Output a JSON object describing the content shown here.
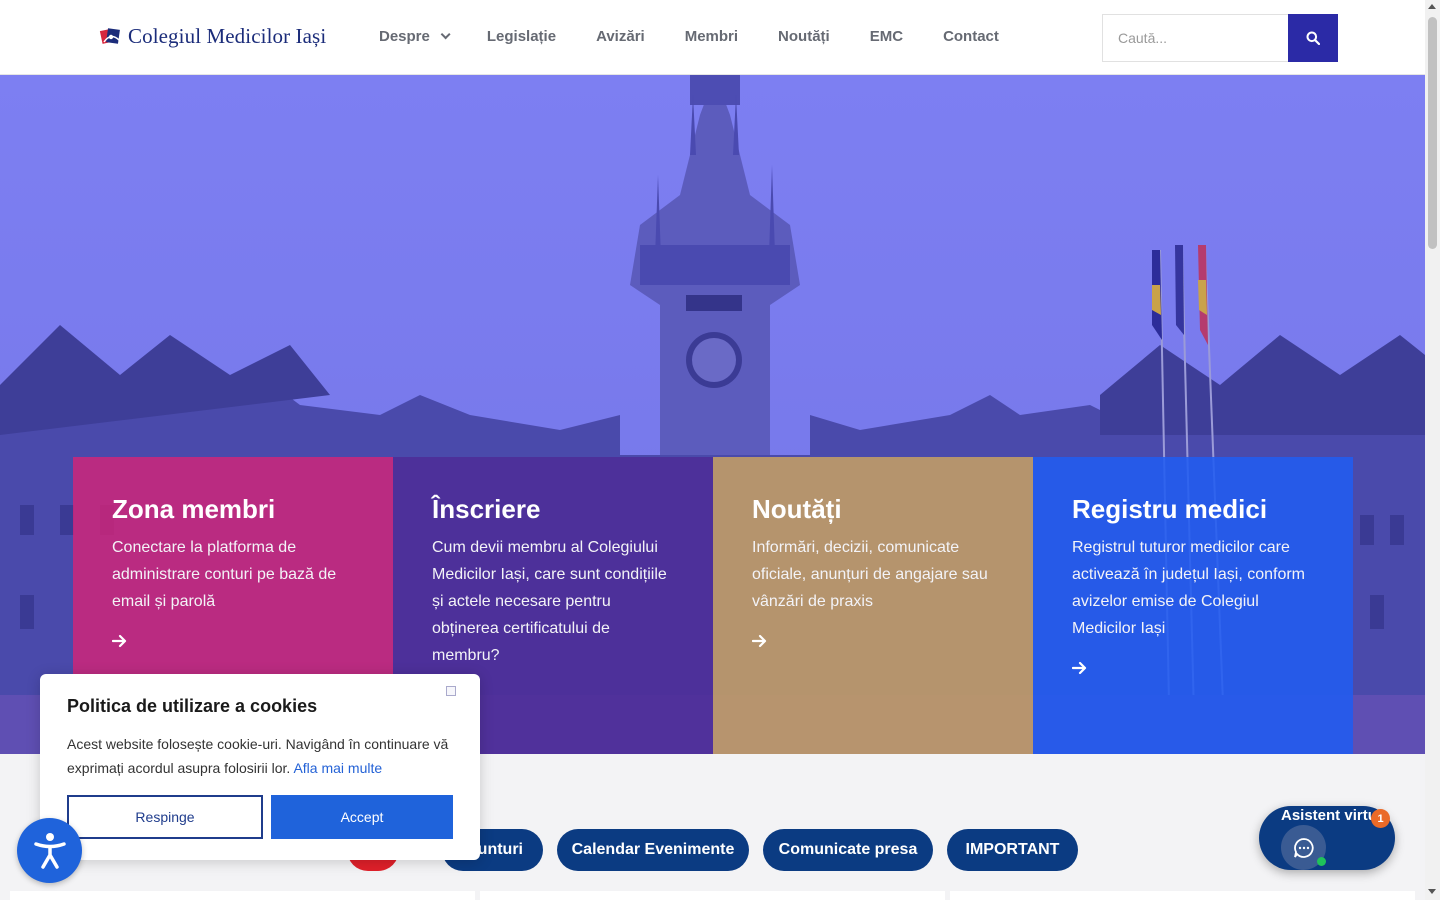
{
  "header": {
    "logo_text": "Colegiul Medicilor Iași",
    "nav": [
      {
        "label": "Despre"
      },
      {
        "label": "Legislație"
      },
      {
        "label": "Avizări"
      },
      {
        "label": "Membri"
      },
      {
        "label": "Noutăți"
      },
      {
        "label": "EMC"
      },
      {
        "label": "Contact"
      }
    ],
    "search_placeholder": "Caută...",
    "search_icon": "search-icon",
    "accent_color": "#2b2aa6"
  },
  "hero": {
    "cards": [
      {
        "title": "Zona membri",
        "desc": "Conectare la platforma de administrare conturi pe bază de email și parolă",
        "color": "#d32478"
      },
      {
        "title": "Înscriere",
        "desc": "Cum devii membru al Colegiului Medicilor Iași, care sunt condițiile și actele necesare pentru obținerea certificatului de membru?",
        "color": "#4e2c96"
      },
      {
        "title": "Noutăți",
        "desc": "Informări, decizii, comunicate oficiale, anunțuri de angajare sau vânzări de praxis",
        "color": "#c49e64"
      },
      {
        "title": "Registru medici",
        "desc": "Registrul tuturor medicilor care activează în județul Iași, conform avizelor emise de Colegiul Medicilor Iași",
        "color": "#215cf0"
      }
    ]
  },
  "filters": {
    "pills": [
      {
        "label": ""
      },
      {
        "label": "Anunturi"
      },
      {
        "label": "Calendar Evenimente"
      },
      {
        "label": "Comunicate presa"
      },
      {
        "label": "IMPORTANT"
      }
    ]
  },
  "cookie": {
    "title": "Politica de utilizare a cookies",
    "text": "Acest website folosește cookie-uri. Navigând în continuare vă exprimați acordul asupra folosirii lor.",
    "link": "Afla mai multe",
    "reject": "Respinge",
    "accept": "Accept"
  },
  "chat": {
    "label": "Asistent virtual",
    "badge": "1"
  }
}
